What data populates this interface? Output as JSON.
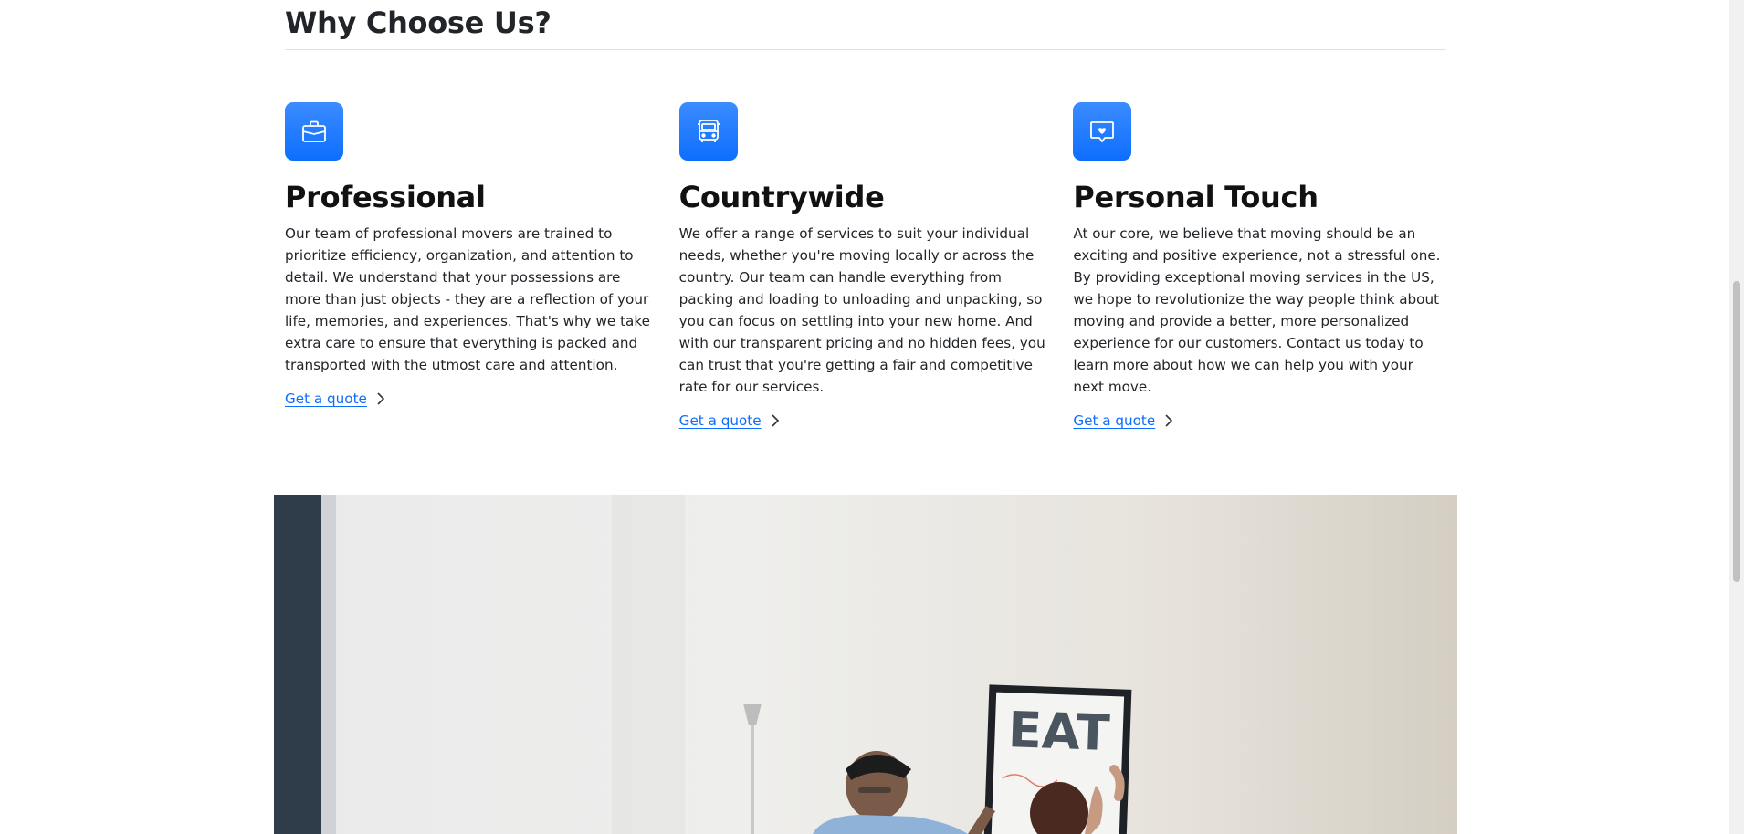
{
  "section": {
    "title": "Why Choose Us?"
  },
  "features": [
    {
      "icon": "briefcase-icon",
      "title": "Professional",
      "text": "Our team of professional movers are trained to prioritize efficiency, organization, and attention to detail. We understand that your possessions are more than just objects - they are a reflection of your life, memories, and experiences. That's why we take extra care to ensure that everything is packed and transported with the utmost care and attention.",
      "link": "Get a quote"
    },
    {
      "icon": "bus-icon",
      "title": "Countrywide",
      "text": "We offer a range of services to suit your individual needs, whether you're moving locally or across the country. Our team can handle everything from packing and loading to unloading and unpacking, so you can focus on settling into your new home. And with our transparent pricing and no hidden fees, you can trust that you're getting a fair and competitive rate for our services.",
      "link": "Get a quote"
    },
    {
      "icon": "chat-heart-icon",
      "title": "Personal Touch",
      "text": "At our core, we believe that moving should be an exciting and positive experience, not a stressful one. By providing exceptional moving services in the US, we hope to revolutionize the way people think about moving and provide a better, more personalized experience for our customers. Contact us today to learn more about how we can help you with your next move.",
      "link": "Get a quote"
    }
  ],
  "hero": {
    "poster_text": "EAT"
  },
  "colors": {
    "accent": "#0d6efd",
    "text": "#212529"
  }
}
